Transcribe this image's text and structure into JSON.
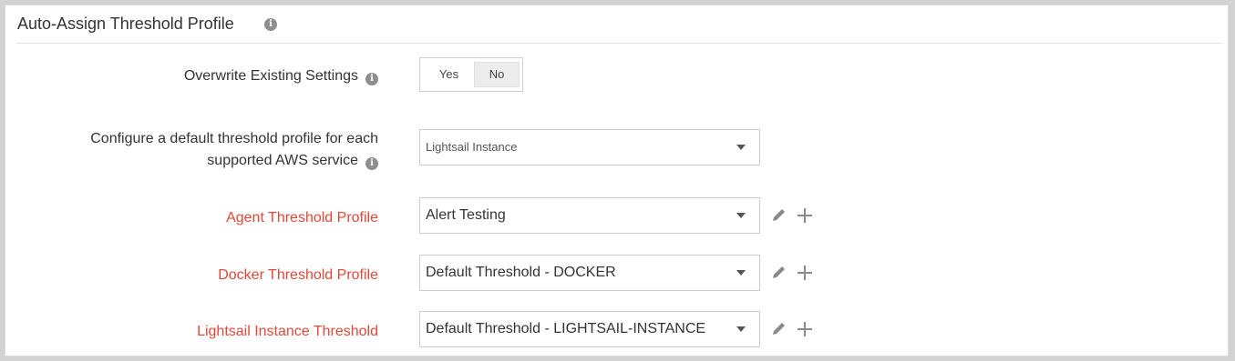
{
  "section": {
    "title": "Auto-Assign Threshold Profile",
    "info_icon": "info-icon"
  },
  "overwrite": {
    "label": "Overwrite Existing Settings",
    "options": [
      "Yes",
      "No"
    ],
    "selected": "No"
  },
  "default_profile": {
    "label_line1": "Configure a default threshold profile for each",
    "label_line2": "supported AWS service",
    "value": "Lightsail Instance"
  },
  "rows": [
    {
      "label": "Agent Threshold Profile",
      "value": "Alert Testing"
    },
    {
      "label": "Docker Threshold Profile",
      "value": "Default Threshold - DOCKER"
    },
    {
      "label": "Lightsail Instance Threshold",
      "value": "Default Threshold - LIGHTSAIL-INSTANCE"
    }
  ],
  "colors": {
    "required_label": "#e0483a",
    "icon_gray": "#8e8e8e"
  }
}
